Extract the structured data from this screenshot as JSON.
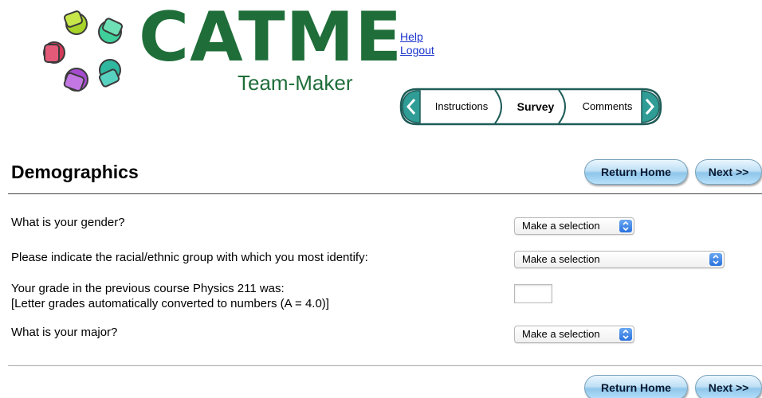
{
  "brand": {
    "name": "CATME",
    "subtitle": "Team-Maker"
  },
  "links": {
    "help": "Help",
    "logout": "Logout"
  },
  "steps": [
    {
      "label": "Instructions",
      "active": false
    },
    {
      "label": "Survey",
      "active": true
    },
    {
      "label": "Comments",
      "active": false
    }
  ],
  "page": {
    "title": "Demographics",
    "return_home_label": "Return Home",
    "next_label": "Next >>"
  },
  "questions": [
    {
      "text": "What is your gender?",
      "control": "select",
      "value": "Make a selection"
    },
    {
      "text": "Please indicate the racial/ethnic group with which you most identify:",
      "control": "select",
      "value": "Make a selection"
    },
    {
      "text": "Your grade in the previous course Physics 211 was:",
      "note": "[Letter grades automatically converted to numbers (A = 4.0)]",
      "control": "text",
      "value": ""
    },
    {
      "text": "What is your major?",
      "control": "select",
      "value": "Make a selection"
    }
  ],
  "colors": {
    "brand_green": "#1f6e3a",
    "nav_teal": "#2f9d96",
    "link_blue": "#1a33cc",
    "button_blue": "#8fc6ea"
  }
}
